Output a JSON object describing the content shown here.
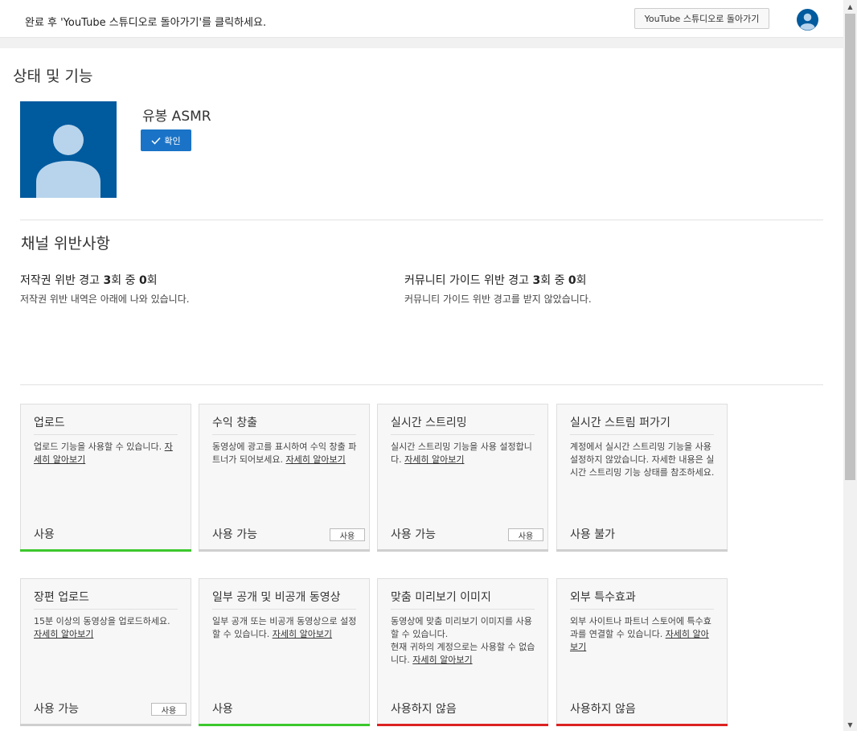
{
  "topbar": {
    "message": "완료 후 'YouTube 스튜디오로 돌아가기'를 클릭하세요.",
    "back_button": "YouTube 스튜디오로 돌아가기"
  },
  "page": {
    "title": "상태 및 기능"
  },
  "profile": {
    "channel_name": "유봉 ASMR",
    "verify_label": "확인"
  },
  "violations": {
    "title": "채널 위반사항",
    "copyright": {
      "prefix": "저작권 위반 경고 ",
      "count": "3",
      "mid": "회 중 ",
      "value": "0",
      "suffix": "회",
      "sub": "저작권 위반 내역은 아래에 나와 있습니다."
    },
    "community": {
      "prefix": "커뮤니티 가이드 위반 경고 ",
      "count": "3",
      "mid": "회 중 ",
      "value": "0",
      "suffix": "회",
      "sub": "커뮤니티 가이드 위반 경고를 받지 않았습니다."
    }
  },
  "features": [
    {
      "title": "업로드",
      "desc": "업로드 기능을 사용할 수 있습니다. ",
      "link": "자세히 알아보기",
      "status": "사용",
      "button": "",
      "bar": "green"
    },
    {
      "title": "수익 창출",
      "desc": "동영상에 광고를 표시하여 수익 창출 파트너가 되어보세요. ",
      "link": "자세히 알아보기",
      "status": "사용 가능",
      "button": "사용",
      "bar": "grey"
    },
    {
      "title": "실시간 스트리밍",
      "desc": "실시간 스트리밍 기능을 사용 설정합니다. ",
      "link": "자세히 알아보기",
      "status": "사용 가능",
      "button": "사용",
      "bar": "grey"
    },
    {
      "title": "실시간 스트림 퍼가기",
      "desc": "계정에서 실시간 스트리밍 기능을 사용 설정하지 않았습니다. 자세한 내용은 실시간 스트리밍 기능 상태를 참조하세요.",
      "link": "",
      "status": "사용 불가",
      "button": "",
      "bar": "grey"
    },
    {
      "title": "장편 업로드",
      "desc": "15분 이상의 동영상을 업로드하세요. ",
      "link": "자세히 알아보기",
      "status": "사용 가능",
      "button": "사용",
      "bar": "grey"
    },
    {
      "title": "일부 공개 및 비공개 동영상",
      "desc": "일부 공개 또는 비공개 동영상으로 설정할 수 있습니다. ",
      "link": "자세히 알아보기",
      "status": "사용",
      "button": "",
      "bar": "green"
    },
    {
      "title": "맞춤 미리보기 이미지",
      "desc": "동영상에 맞춤 미리보기 이미지를 사용할 수 있습니다.\n현재 귀하의 계정으로는 사용할 수 없습니다. ",
      "link": "자세히 알아보기",
      "status": "사용하지 않음",
      "button": "",
      "bar": "red"
    },
    {
      "title": "외부 특수효과",
      "desc": "외부 사이트나 파트너 스토어에 특수효과를 연결할 수 있습니다. ",
      "link": "자세히 알아보기",
      "status": "사용하지 않음",
      "button": "",
      "bar": "red"
    }
  ],
  "colors": {
    "accent": "#1a73c7",
    "enabled": "#3cc82d",
    "disabled": "#dd2222",
    "profile_bg": "#005a9e"
  },
  "icons": {
    "avatar": "account-avatar-icon",
    "check": "checkmark-icon",
    "scroll_up": "triangle-up",
    "scroll_down": "triangle-down"
  }
}
